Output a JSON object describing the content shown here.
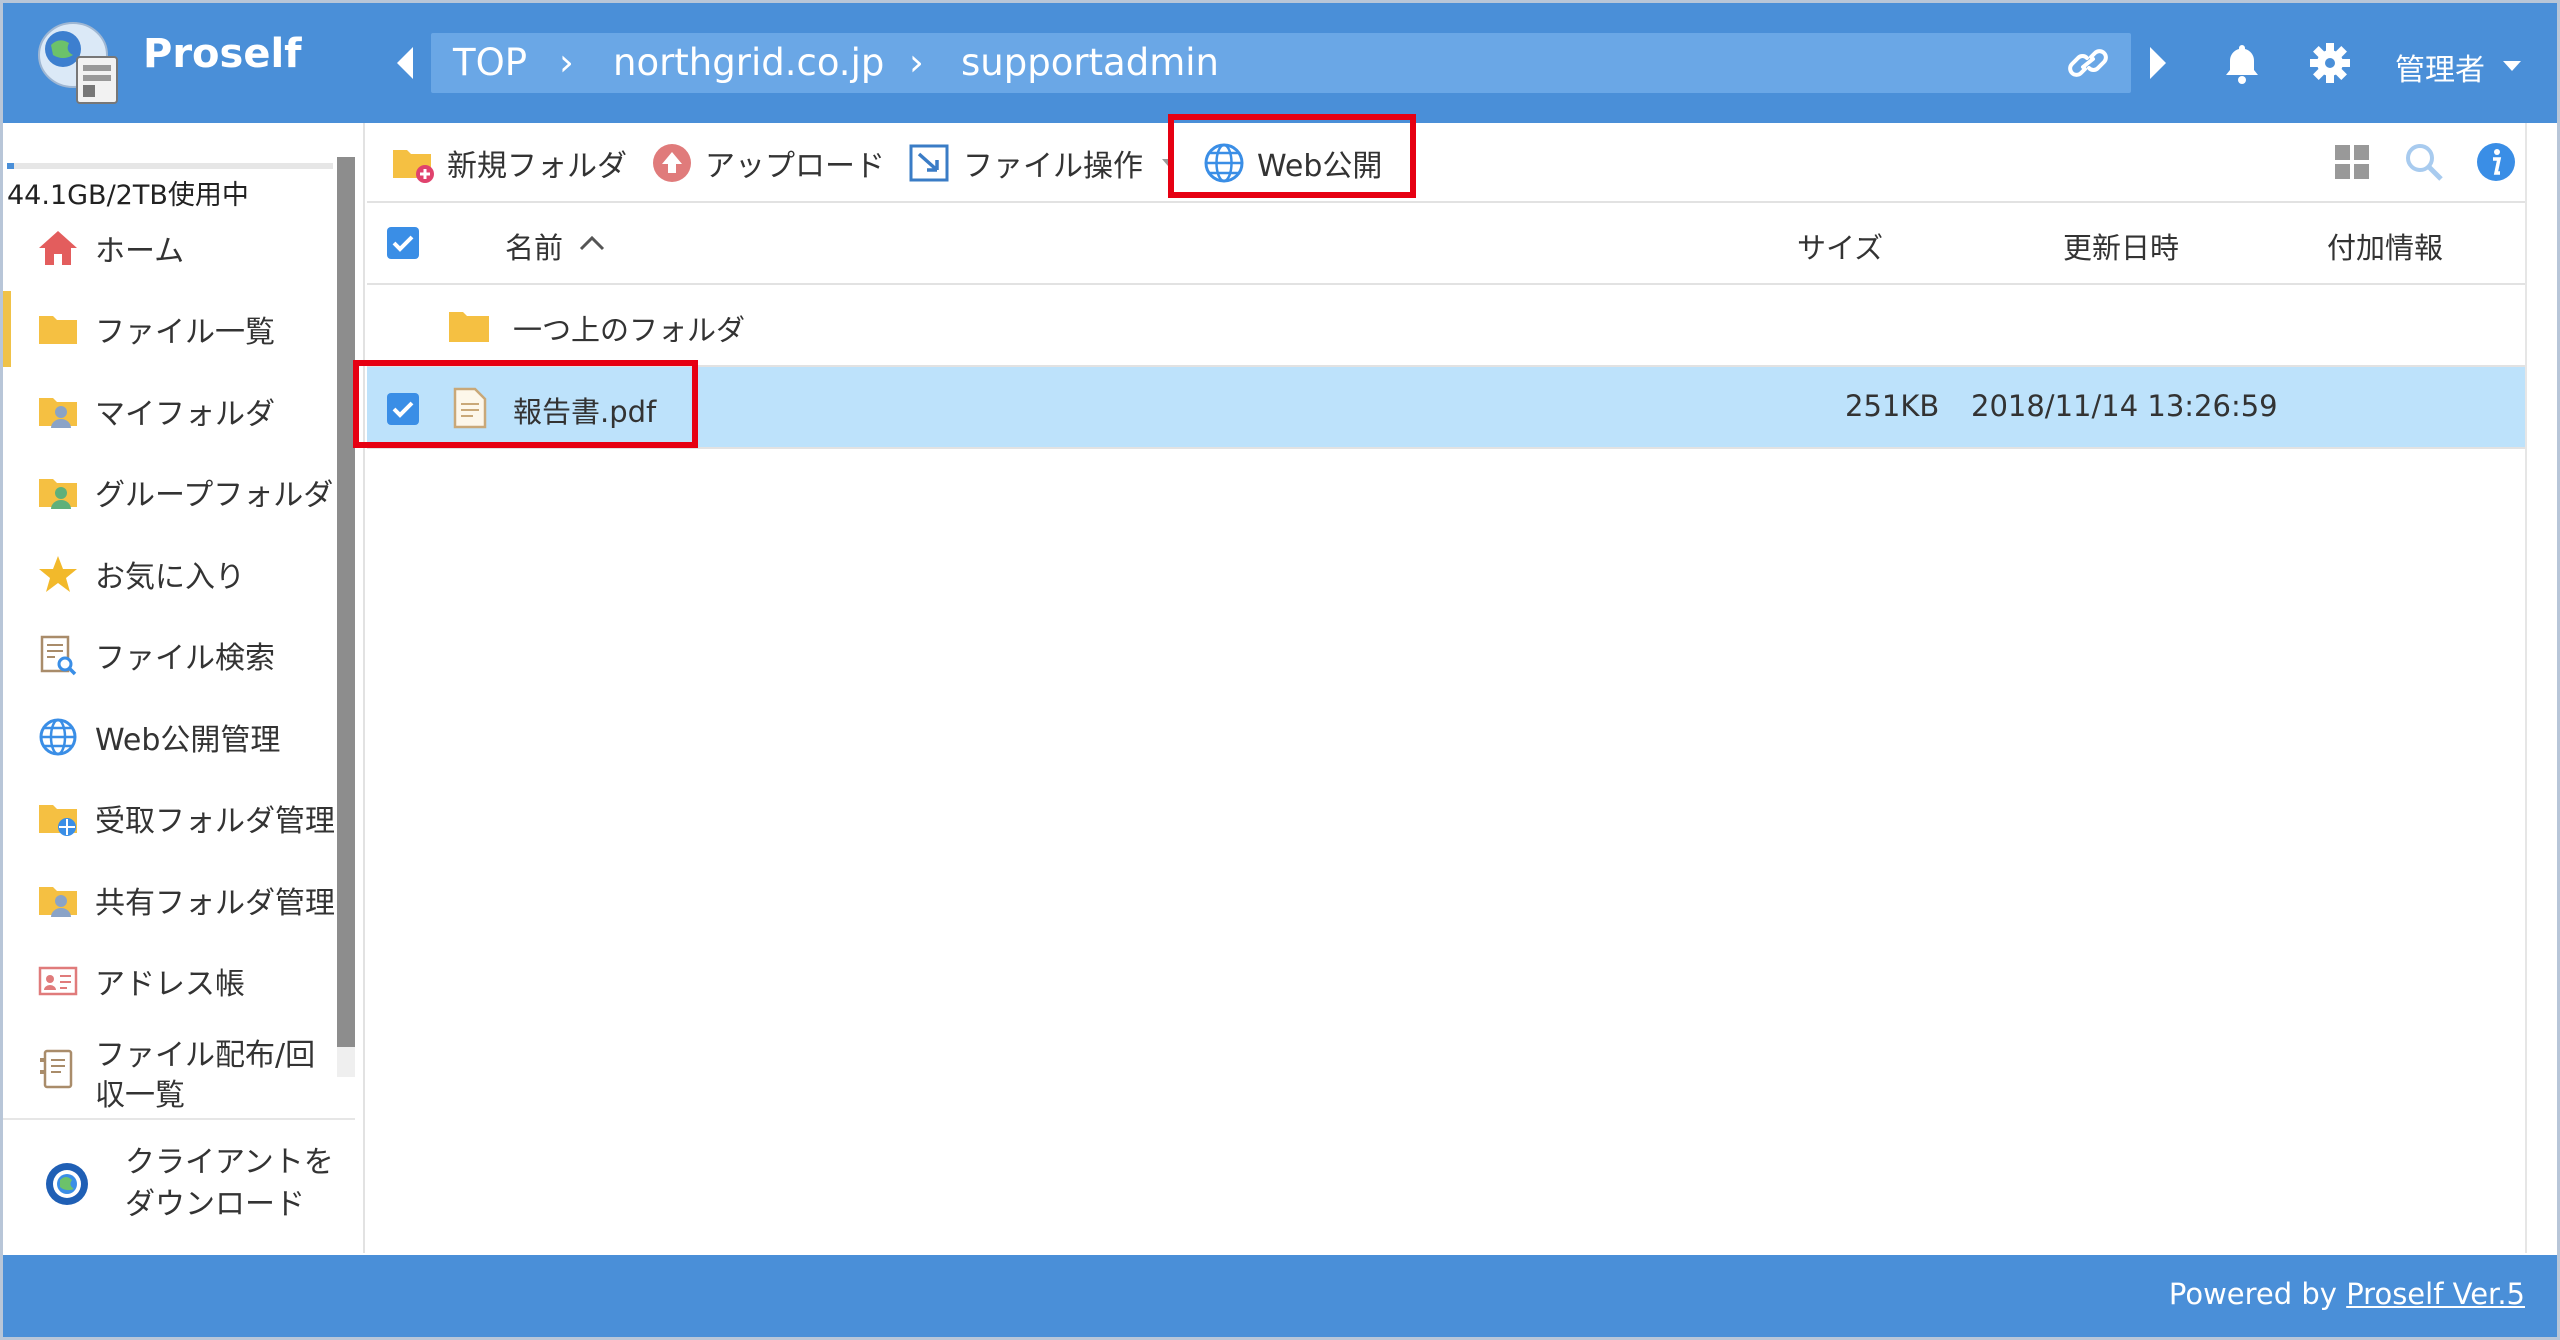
{
  "app": {
    "title": "Proself"
  },
  "breadcrumb": [
    "TOP",
    "northgrid.co.jp",
    "supportadmin"
  ],
  "header": {
    "user_label": "管理者"
  },
  "sidebar": {
    "usage_text": "44.1GB/2TB使用中",
    "usage_fraction": 0.022,
    "items": [
      {
        "label": "ホーム",
        "icon": "home-icon"
      },
      {
        "label": "ファイル一覧",
        "icon": "folder-icon",
        "active": true
      },
      {
        "label": "マイフォルダ",
        "icon": "my-folder-icon"
      },
      {
        "label": "グループフォルダ",
        "icon": "group-folder-icon"
      },
      {
        "label": "お気に入り",
        "icon": "star-icon"
      },
      {
        "label": "ファイル検索",
        "icon": "file-search-icon"
      },
      {
        "label": "Web公開管理",
        "icon": "globe-icon"
      },
      {
        "label": "受取フォルダ管理",
        "icon": "receive-folder-icon"
      },
      {
        "label": "共有フォルダ管理",
        "icon": "shared-folder-icon"
      },
      {
        "label": "アドレス帳",
        "icon": "address-book-icon"
      },
      {
        "label": "ファイル配布/回収一覧",
        "icon": "distribution-icon"
      }
    ],
    "client_download": {
      "label_line1": "クライアントを",
      "label_line2": "ダウンロード"
    }
  },
  "toolbar": {
    "new_folder": "新規フォルダ",
    "upload": "アップロード",
    "file_ops": "ファイル操作",
    "web_publish": "Web公開"
  },
  "table": {
    "headers": {
      "name": "名前",
      "size": "サイズ",
      "modified": "更新日時",
      "extra": "付加情報"
    },
    "parent_row": {
      "name": "一つ上のフォルダ"
    },
    "rows": [
      {
        "name": "報告書.pdf",
        "size": "251KB",
        "modified": "2018/11/14 13:26:59",
        "extra": "",
        "checked": true
      }
    ]
  },
  "footer": {
    "prefix": "Powered by ",
    "link": "Proself Ver.5"
  },
  "colors": {
    "header_bg": "#4a8fd8",
    "selected_row": "#bde2fb",
    "highlight": "#e60012",
    "active_marker": "#f0c248"
  }
}
